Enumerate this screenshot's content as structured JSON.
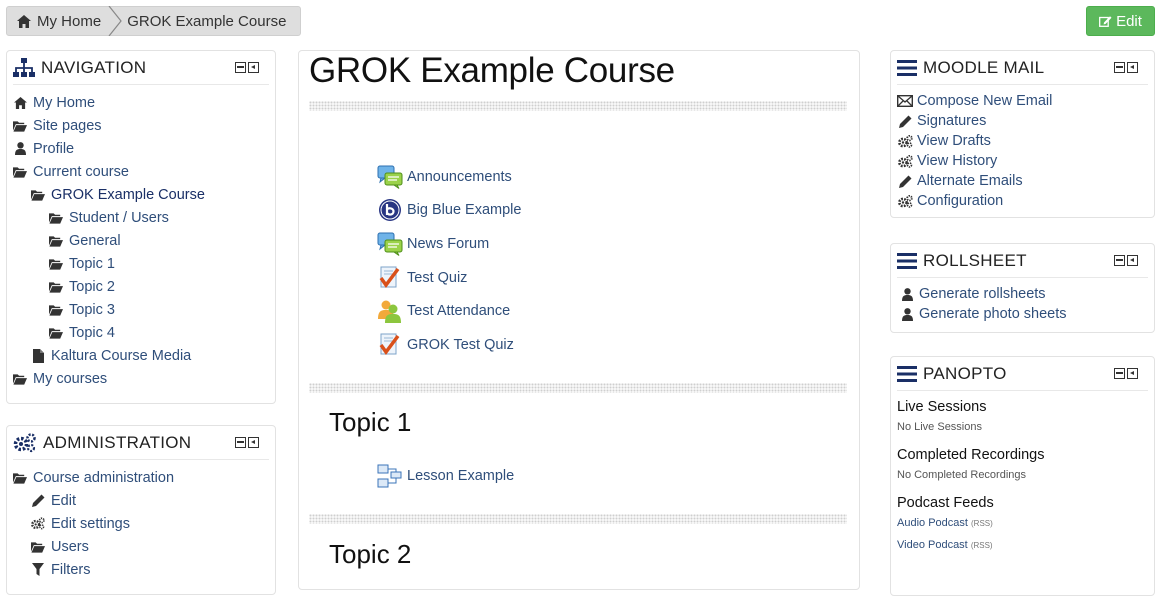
{
  "breadcrumb": {
    "home": "My Home",
    "current": "GROK Example Course"
  },
  "edit_button": "Edit",
  "colors": {
    "edit_button": "#5cb85c",
    "link": "#2f4e7a"
  },
  "navigation": {
    "title": "NAVIGATION",
    "items": [
      {
        "label": "My Home",
        "icon": "home-icon"
      },
      {
        "label": "Site pages",
        "icon": "folder-open-icon"
      },
      {
        "label": "Profile",
        "icon": "user-icon"
      },
      {
        "label": "Current course",
        "icon": "folder-open-icon"
      },
      {
        "label": "GROK Example Course",
        "icon": "folder-open-icon"
      },
      {
        "label": "Student / Users",
        "icon": "folder-open-icon"
      },
      {
        "label": "General",
        "icon": "folder-open-icon"
      },
      {
        "label": "Topic 1",
        "icon": "folder-open-icon"
      },
      {
        "label": "Topic 2",
        "icon": "folder-open-icon"
      },
      {
        "label": "Topic 3",
        "icon": "folder-open-icon"
      },
      {
        "label": "Topic 4",
        "icon": "folder-open-icon"
      },
      {
        "label": "Kaltura Course Media",
        "icon": "file-icon"
      },
      {
        "label": "My courses",
        "icon": "folder-open-icon"
      }
    ]
  },
  "administration": {
    "title": "ADMINISTRATION",
    "items": [
      {
        "label": "Course administration",
        "icon": "folder-open-icon"
      },
      {
        "label": "Edit",
        "icon": "pencil-icon"
      },
      {
        "label": "Edit settings",
        "icon": "cogs-icon"
      },
      {
        "label": "Users",
        "icon": "folder-open-icon"
      },
      {
        "label": "Filters",
        "icon": "filter-icon"
      }
    ]
  },
  "main": {
    "course_title": "GROK Example Course",
    "activities": [
      {
        "label": "Announcements",
        "icon": "forum-icon"
      },
      {
        "label": "Big Blue Example",
        "icon": "bigbluebutton-icon"
      },
      {
        "label": "News Forum",
        "icon": "forum-icon"
      },
      {
        "label": "Test Quiz",
        "icon": "quiz-icon"
      },
      {
        "label": "Test Attendance",
        "icon": "attendance-icon"
      },
      {
        "label": "GROK Test Quiz",
        "icon": "quiz-icon"
      }
    ],
    "topic1": {
      "title": "Topic 1",
      "activities": [
        {
          "label": "Lesson Example",
          "icon": "lesson-icon"
        }
      ]
    },
    "topic2": {
      "title": "Topic 2"
    }
  },
  "moodle_mail": {
    "title": "MOODLE MAIL",
    "items": [
      {
        "label": "Compose New Email",
        "icon": "envelope-icon"
      },
      {
        "label": "Signatures",
        "icon": "pencil-icon"
      },
      {
        "label": "View Drafts",
        "icon": "cogs-icon"
      },
      {
        "label": "View History",
        "icon": "cogs-icon"
      },
      {
        "label": "Alternate Emails",
        "icon": "pencil-icon"
      },
      {
        "label": "Configuration",
        "icon": "cogs-icon"
      }
    ]
  },
  "rollsheet": {
    "title": "ROLLSHEET",
    "items": [
      {
        "label": "Generate rollsheets",
        "icon": "user-icon"
      },
      {
        "label": "Generate photo sheets",
        "icon": "user-icon"
      }
    ]
  },
  "panopto": {
    "title": "PANOPTO",
    "live_heading": "Live Sessions",
    "live_text": "No Live Sessions",
    "completed_heading": "Completed Recordings",
    "completed_text": "No Completed Recordings",
    "podcast_heading": "Podcast Feeds",
    "audio_podcast": "Audio Podcast",
    "video_podcast": "Video Podcast",
    "rss": "(RSS)"
  }
}
